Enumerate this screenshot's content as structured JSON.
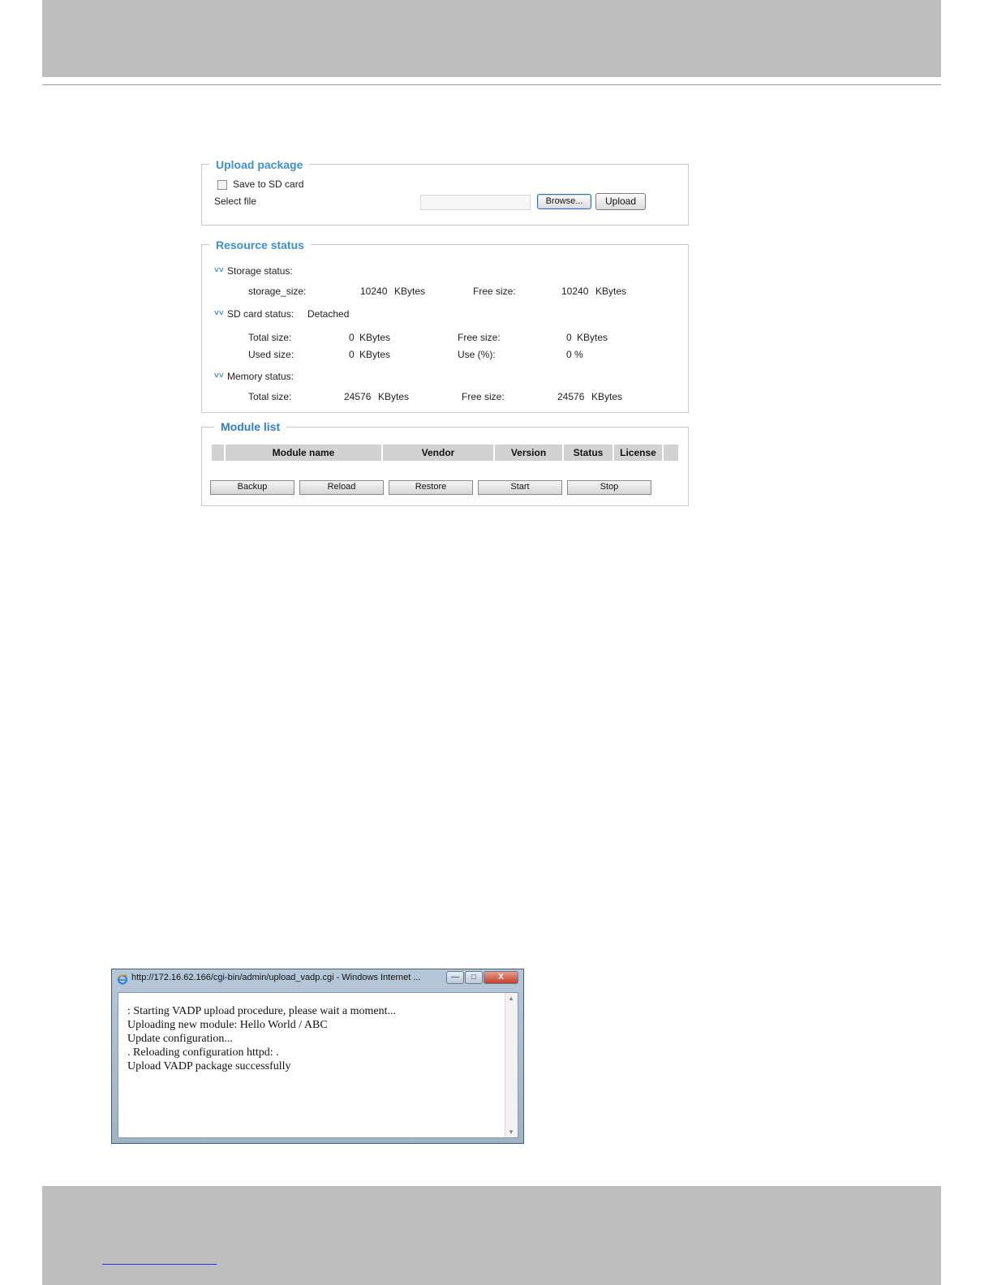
{
  "upload_package": {
    "legend": "Upload package",
    "save_to_sd_label": "Save to SD card",
    "select_file_label": "Select file",
    "file_value": "",
    "browse_label": "Browse...",
    "upload_label": "Upload"
  },
  "resource_status": {
    "legend": "Resource status",
    "storage": {
      "heading": "Storage status:",
      "size_label": "storage_size:",
      "size_value": "10240",
      "size_unit": "KBytes",
      "free_label": "Free size:",
      "free_value": "10240",
      "free_unit": "KBytes"
    },
    "sd_card": {
      "heading": "SD card status:",
      "state": "Detached",
      "total_label": "Total size:",
      "total_value": "0",
      "total_unit": "KBytes",
      "free_label": "Free size:",
      "free_value": "0",
      "free_unit": "KBytes",
      "used_label": "Used size:",
      "used_value": "0",
      "used_unit": "KBytes",
      "use_pct_label": "Use (%):",
      "use_pct_value": "0 %"
    },
    "memory": {
      "heading": "Memory status:",
      "total_label": "Total size:",
      "total_value": "24576",
      "total_unit": "KBytes",
      "free_label": "Free size:",
      "free_value": "24576",
      "free_unit": "KBytes"
    }
  },
  "module_list": {
    "legend": "Module list",
    "columns": [
      "Module name",
      "Vendor",
      "Version",
      "Status",
      "License"
    ],
    "buttons": [
      "Backup",
      "Reload",
      "Restore",
      "Start",
      "Stop"
    ]
  },
  "popup": {
    "title": "http://172.16.62.166/cgi-bin/admin/upload_vadp.cgi - Windows Internet ...",
    "controls": {
      "minimize": "—",
      "maximize": "□",
      "close": "X"
    },
    "lines": [
      ": Starting VADP upload procedure, please wait a moment...",
      "Uploading new module: Hello World / ABC",
      "Update configuration...",
      ". Reloading configuration httpd: .",
      "Upload VADP package successfully"
    ]
  },
  "icons": {
    "chevron": "double-chevron-down-icon",
    "browser": "internet-explorer-icon"
  },
  "colors": {
    "accent": "#3f8fd2",
    "band": "#bebebe",
    "header_cell": "#d2d2d2"
  }
}
